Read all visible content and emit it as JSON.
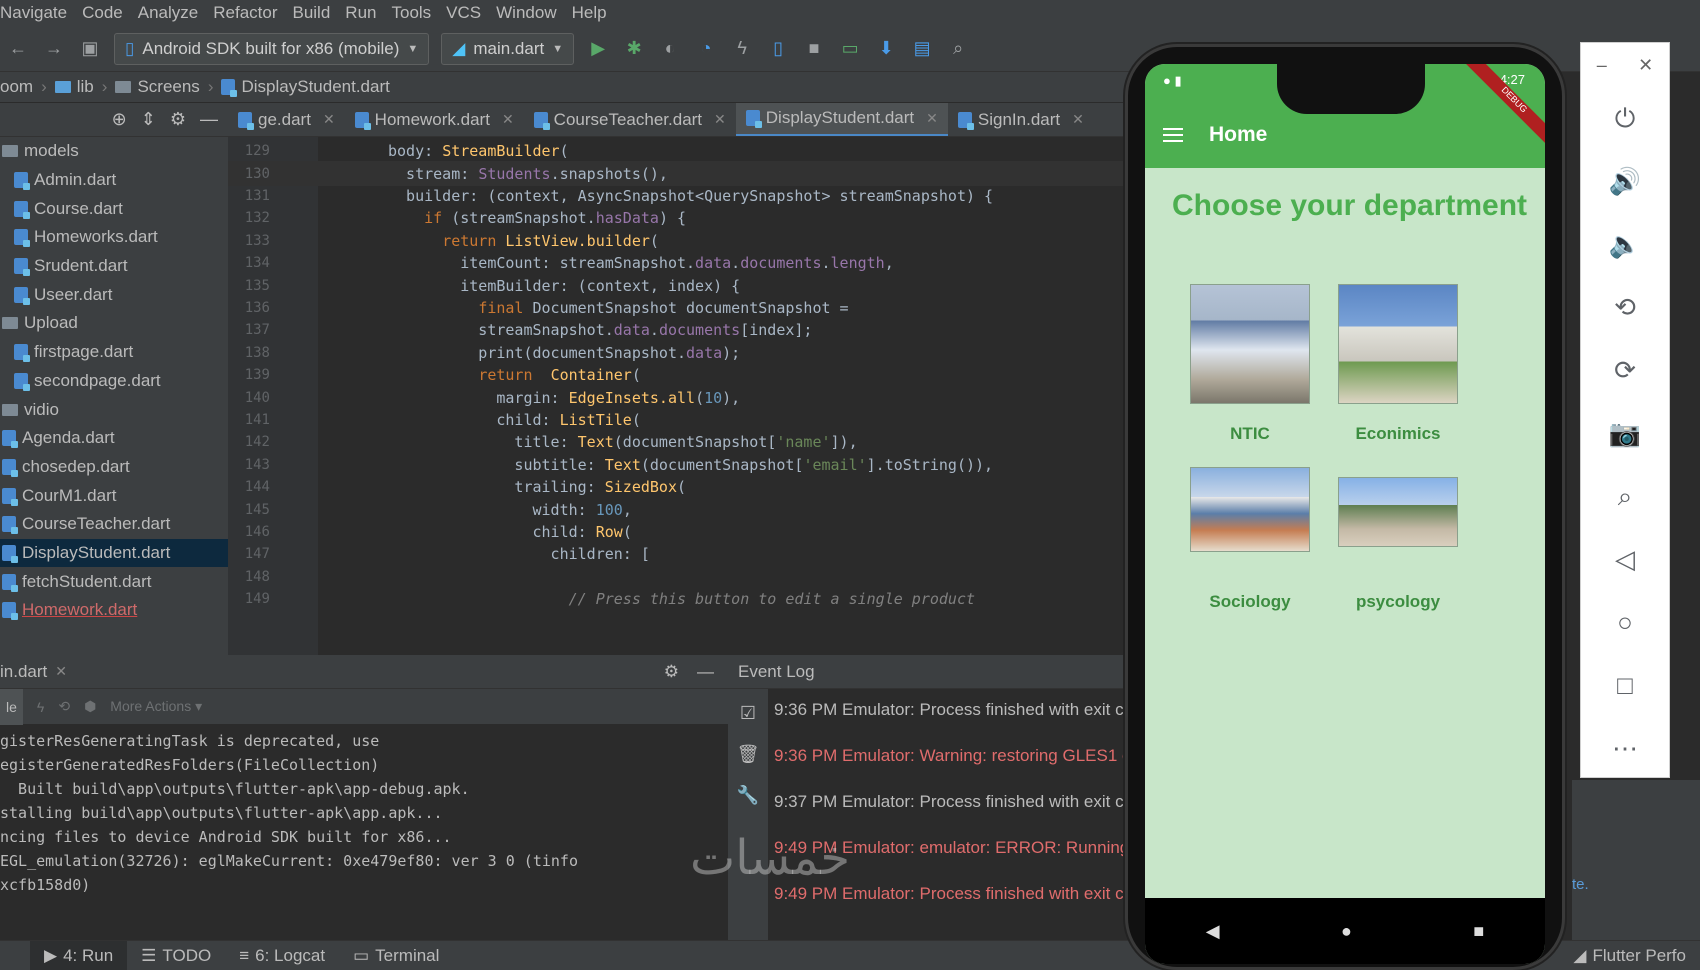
{
  "menu": [
    "Navigate",
    "Code",
    "Analyze",
    "Refactor",
    "Build",
    "Run",
    "Tools",
    "VCS",
    "Window",
    "Help"
  ],
  "toolbar": {
    "device_combo": "Android SDK built for x86 (mobile)",
    "run_config": "main.dart",
    "icons": [
      "back-arrow-icon",
      "forward-arrow-icon",
      "layout-icon",
      "run-icon",
      "debug-bug-icon",
      "attach-icon",
      "profile-icon",
      "apply-changes-icon",
      "apply-code-icon",
      "stop-icon",
      "avd-manager-icon",
      "sdk-manager-icon",
      "project-structure-icon",
      "search-icon"
    ]
  },
  "breadcrumb": [
    "oom",
    "lib",
    "Screens",
    "DisplayStudent.dart"
  ],
  "project_tree": [
    {
      "label": "models",
      "type": "folder"
    },
    {
      "label": "Admin.dart",
      "type": "file"
    },
    {
      "label": "Course.dart",
      "type": "file"
    },
    {
      "label": "Homeworks.dart",
      "type": "file"
    },
    {
      "label": "Srudent.dart",
      "type": "file"
    },
    {
      "label": "Useer.dart",
      "type": "file"
    },
    {
      "label": "Upload",
      "type": "folder"
    },
    {
      "label": "firstpage.dart",
      "type": "file"
    },
    {
      "label": "secondpage.dart",
      "type": "file"
    },
    {
      "label": "vidio",
      "type": "folder"
    },
    {
      "label": "Agenda.dart",
      "type": "file0"
    },
    {
      "label": "chosedep.dart",
      "type": "file0"
    },
    {
      "label": "CourM1.dart",
      "type": "file0"
    },
    {
      "label": "CourseTeacher.dart",
      "type": "file0"
    },
    {
      "label": "DisplayStudent.dart",
      "type": "file0",
      "selected": true
    },
    {
      "label": "fetchStudent.dart",
      "type": "file0"
    },
    {
      "label": "Homework.dart",
      "type": "file0",
      "error": true
    }
  ],
  "editor_tabs": [
    {
      "label": "ge.dart",
      "active": false
    },
    {
      "label": "Homework.dart",
      "active": false
    },
    {
      "label": "CourseTeacher.dart",
      "active": false
    },
    {
      "label": "DisplayStudent.dart",
      "active": true
    },
    {
      "label": "SignIn.dart",
      "active": false
    }
  ],
  "code_lines": [
    {
      "n": "129",
      "html": "body: <span class=\"cls\">StreamBuilder</span>("
    },
    {
      "n": "130",
      "html": "  stream: <span class=\"field\">Students</span>.snapshots(),"
    },
    {
      "n": "131",
      "html": "  builder: (context, AsyncSnapshot&lt;QuerySnapshot&gt; streamSnapshot) {"
    },
    {
      "n": "132",
      "html": "    <span class=\"kw\">if</span> (streamSnapshot.<span class=\"field\">hasData</span>) {"
    },
    {
      "n": "133",
      "html": "      <span class=\"kw\">return</span> <span class=\"cls\">ListView.builder</span>("
    },
    {
      "n": "134",
      "html": "        itemCount: streamSnapshot.<span class=\"field\">data</span>.<span class=\"field\">documents</span>.<span class=\"field\">length</span>,"
    },
    {
      "n": "135",
      "html": "        itemBuilder: (context, index) {"
    },
    {
      "n": "136",
      "html": "          <span class=\"kw\">final</span> DocumentSnapshot documentSnapshot ="
    },
    {
      "n": "137",
      "html": "          streamSnapshot.<span class=\"field\">data</span>.<span class=\"field\">documents</span>[index];"
    },
    {
      "n": "138",
      "html": "          print(documentSnapshot.<span class=\"field\">data</span>);"
    },
    {
      "n": "139",
      "html": "          <span class=\"kw\">return</span>  <span class=\"cls\">Container</span>("
    },
    {
      "n": "140",
      "html": "            margin: <span class=\"cls\">EdgeInsets.all</span>(<span class=\"num\">10</span>),"
    },
    {
      "n": "141",
      "html": "            child: <span class=\"cls\">ListTile</span>("
    },
    {
      "n": "142",
      "html": "              title: <span class=\"cls\">Text</span>(documentSnapshot[<span class=\"str\">'name'</span>]),"
    },
    {
      "n": "143",
      "html": "              subtitle: <span class=\"cls\">Text</span>(documentSnapshot[<span class=\"str\">'email'</span>].toString()),"
    },
    {
      "n": "144",
      "html": "              trailing: <span class=\"cls\">SizedBox</span>("
    },
    {
      "n": "145",
      "html": "                width: <span class=\"num\">100</span>,"
    },
    {
      "n": "146",
      "html": "                child: <span class=\"cls\">Row</span>("
    },
    {
      "n": "147",
      "html": "                  children: ["
    },
    {
      "n": "148",
      "html": ""
    },
    {
      "n": "149",
      "html": "                    <span class=\"cmt\">// Press this button to edit a single product</span>"
    }
  ],
  "run_panel": {
    "tab": "in.dart",
    "console": [
      "gisterResGeneratingTask is deprecated, use",
      "egisterGeneratedResFolders(FileCollection)",
      "  Built build\\app\\outputs\\flutter-apk\\app-debug.apk.",
      "stalling build\\app\\outputs\\flutter-apk\\app.apk...",
      "ncing files to device Android SDK built for x86...",
      "EGL_emulation(32726): eglMakeCurrent: 0xe479ef80: ver 3 0 (tinfo",
      "xcfb158d0)"
    ]
  },
  "event_log": {
    "title": "Event Log",
    "entries": [
      {
        "text": "9:36 PM  Emulator: Process finished with exit c",
        "warn": false
      },
      {
        "text": "9:36 PM  Emulator: Warning: restoring GLES1 c",
        "warn": true
      },
      {
        "text": "9:37 PM  Emulator: Process finished with exit c",
        "warn": false
      },
      {
        "text": "9:49 PM  Emulator: emulator: ERROR: Running",
        "warn": true
      },
      {
        "text": "9:49 PM  Emulator: Process finished with exit c",
        "warn": true
      }
    ]
  },
  "statusbar": [
    {
      "label": "4: Run",
      "active": true
    },
    {
      "label": "TODO",
      "active": false
    },
    {
      "label": "6: Logcat",
      "active": false
    },
    {
      "label": "Terminal",
      "active": false
    },
    {
      "label": "Flutter Perfo",
      "active": false
    }
  ],
  "phone": {
    "status_time": "4:27",
    "debug_banner": "DEBUG",
    "app_title": "Home",
    "heading": "Choose your department",
    "departments": [
      {
        "label": "NTIC"
      },
      {
        "label": "Econimics"
      },
      {
        "label": "Sociology"
      },
      {
        "label": "psycology"
      }
    ]
  },
  "emulator_controls": [
    "power-icon",
    "volume-up-icon",
    "volume-down-icon",
    "rotate-left-icon",
    "rotate-right-icon",
    "camera-icon",
    "zoom-icon",
    "back-icon",
    "home-icon",
    "overview-icon",
    "more-icon"
  ],
  "watermark": "خمسات",
  "right_link": "te."
}
